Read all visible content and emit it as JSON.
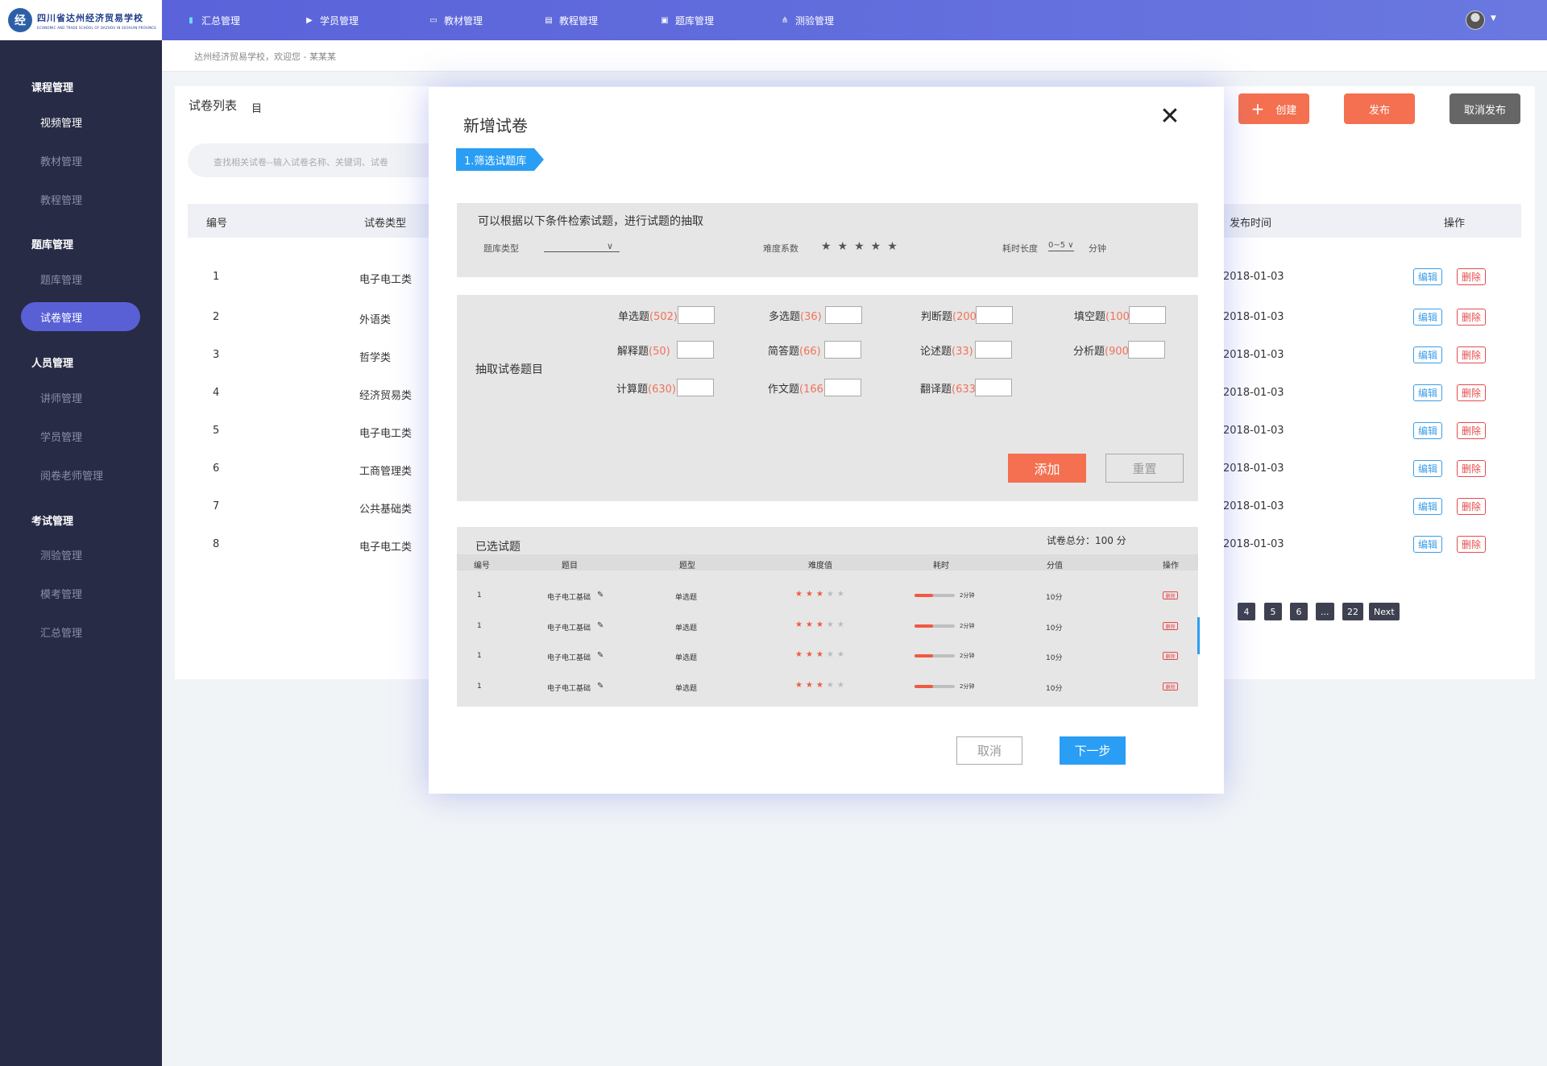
{
  "header": {
    "logo_mark": "经",
    "logo_cn": "四川省达州经济贸易学校",
    "logo_en": "ECONOMIC AND TRADE SCHOOL OF DAZHOU IN SICHUAN PROVINCE",
    "nav": [
      {
        "label": "汇总管理",
        "icon": "book-icon",
        "active": true
      },
      {
        "label": "学员管理",
        "icon": "play-circle-icon",
        "active": false
      },
      {
        "label": "教材管理",
        "icon": "screen-icon",
        "active": false
      },
      {
        "label": "教程管理",
        "icon": "document-icon",
        "active": false
      },
      {
        "label": "题库管理",
        "icon": "monitor-icon",
        "active": false
      },
      {
        "label": "测验管理",
        "icon": "hierarchy-icon",
        "active": false
      }
    ]
  },
  "sidebar": {
    "groups": [
      {
        "title": "课程管理",
        "items": [
          "视频管理",
          "教材管理",
          "教程管理"
        ]
      },
      {
        "title": "题库管理",
        "items": [
          "题库管理",
          "试卷管理"
        ]
      },
      {
        "title": "人员管理",
        "items": [
          "讲师管理",
          "学员管理",
          "阅卷老师管理"
        ]
      },
      {
        "title": "考试管理",
        "items": [
          "测验管理",
          "模考管理",
          "汇总管理"
        ]
      }
    ],
    "active_item": "试卷管理"
  },
  "breadcrumb": "达州经济贸易学校，欢迎您 - 某某某",
  "list": {
    "title": "试卷列表",
    "title_icon": "目",
    "search_placeholder": "查找相关试卷--输入试卷名称、关键词、试卷",
    "buttons": {
      "create": "创建",
      "create_icon": "+",
      "publish": "发布",
      "unpublish": "取消发布"
    },
    "columns": {
      "id": "编号",
      "type": "试卷类型",
      "date": "发布时间",
      "ops": "操作"
    },
    "rows": [
      {
        "id": "1",
        "type": "电子电工类",
        "date": "2018-01-03"
      },
      {
        "id": "2",
        "type": "外语类",
        "date": "2018-01-03"
      },
      {
        "id": "3",
        "type": "哲学类",
        "date": "2018-01-03"
      },
      {
        "id": "4",
        "type": "经济贸易类",
        "date": "2018-01-03"
      },
      {
        "id": "5",
        "type": "电子电工类",
        "date": "2018-01-03"
      },
      {
        "id": "6",
        "type": "工商管理类",
        "date": "2018-01-03"
      },
      {
        "id": "7",
        "type": "公共基础类",
        "date": "2018-01-03"
      },
      {
        "id": "8",
        "type": "电子电工类",
        "date": "2018-01-03"
      }
    ],
    "edit_label": "编辑",
    "delete_label": "删除",
    "pagination": [
      "4",
      "5",
      "6",
      "...",
      "22",
      "Next"
    ]
  },
  "modal": {
    "title": "新增试卷",
    "close": "✕",
    "step": "1.筛选试题库",
    "filter": {
      "hint": "可以根据以下条件检索试题，进行试题的抽取",
      "bank_type_label": "题库类型",
      "bank_type_chevron": "∨",
      "difficulty_label": "难度系数",
      "difficulty_stars": "★★★★★",
      "duration_label": "耗时长度",
      "duration_value": "0~5 ∨",
      "duration_unit": "分钟"
    },
    "extract": {
      "label": "抽取试卷题目",
      "types": [
        {
          "name": "单选题",
          "count": "(502)"
        },
        {
          "name": "多选题",
          "count": "(36)"
        },
        {
          "name": "判断题",
          "count": "(200)"
        },
        {
          "name": "填空题",
          "count": "(100)"
        },
        {
          "name": "解释题",
          "count": "(50)"
        },
        {
          "name": "简答题",
          "count": "(66)"
        },
        {
          "name": "论述题",
          "count": "(33)"
        },
        {
          "name": "分析题",
          "count": "(900)"
        },
        {
          "name": "计算题",
          "count": "(630)"
        },
        {
          "name": "作文题",
          "count": "(166)"
        },
        {
          "name": "翻译题",
          "count": "(633)"
        }
      ],
      "add_label": "添加",
      "reset_label": "重置"
    },
    "selected": {
      "title": "已选试题",
      "total": "试卷总分：100 分",
      "columns": [
        "编号",
        "题目",
        "题型",
        "难度值",
        "耗时",
        "分值",
        "操作"
      ],
      "rows": [
        {
          "id": "1",
          "subject": "电子电工基础",
          "qtype": "单选题",
          "difficulty": 3,
          "time_fraction": 0.45,
          "time": "2分钟",
          "score": "10分"
        },
        {
          "id": "1",
          "subject": "电子电工基础",
          "qtype": "单选题",
          "difficulty": 3,
          "time_fraction": 0.45,
          "time": "2分钟",
          "score": "10分"
        },
        {
          "id": "1",
          "subject": "电子电工基础",
          "qtype": "单选题",
          "difficulty": 3,
          "time_fraction": 0.45,
          "time": "2分钟",
          "score": "10分"
        },
        {
          "id": "1",
          "subject": "电子电工基础",
          "qtype": "单选题",
          "difficulty": 3,
          "time_fraction": 0.45,
          "time": "2分钟",
          "score": "10分"
        }
      ],
      "edit_glyph": "✎",
      "delete_label": "删除"
    },
    "cancel_label": "取消",
    "next_label": "下一步"
  },
  "colors": {
    "accent": "#5960d6",
    "primary_blue": "#2a9ef4",
    "danger": "#e64b4b",
    "orange": "#f47050"
  }
}
